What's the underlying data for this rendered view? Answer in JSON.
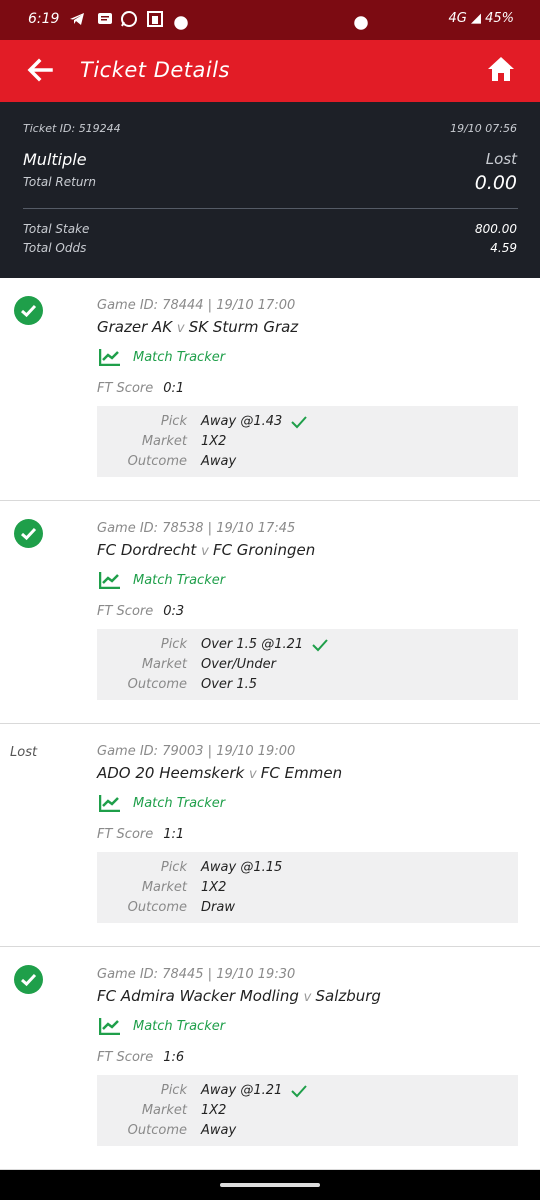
{
  "status_bar": {
    "time": "6:19",
    "right_text": "4G ◢ 45%"
  },
  "header": {
    "title": "Ticket Details"
  },
  "summary": {
    "ticket_id": "Ticket ID: 519244",
    "datetime": "19/10 07:56",
    "bet_type": "Multiple",
    "result": "Lost",
    "total_return_label": "Total Return",
    "total_return_value": "0.00",
    "total_stake_label": "Total Stake",
    "total_stake_value": "800.00",
    "total_odds_label": "Total Odds",
    "total_odds_value": "4.59"
  },
  "labels": {
    "match_tracker": "Match Tracker",
    "ft_score": "FT Score",
    "pick": "Pick",
    "market": "Market",
    "outcome": "Outcome",
    "versus": "v"
  },
  "games": [
    {
      "status": "won",
      "game_id": "Game ID: 78444 | 19/10 17:00",
      "home": "Grazer AK",
      "away": "SK Sturm Graz",
      "ft_score": "0:1",
      "pick": "Away @1.43",
      "market": "1X2",
      "outcome": "Away"
    },
    {
      "status": "won",
      "game_id": "Game ID: 78538 | 19/10 17:45",
      "home": "FC Dordrecht",
      "away": "FC Groningen",
      "ft_score": "0:3",
      "pick": "Over 1.5 @1.21",
      "market": "Over/Under",
      "outcome": "Over 1.5"
    },
    {
      "status": "lost",
      "status_label": "Lost",
      "game_id": "Game ID: 79003 | 19/10 19:00",
      "home": "ADO 20 Heemskerk",
      "away": "FC Emmen",
      "ft_score": "1:1",
      "pick": "Away @1.15",
      "market": "1X2",
      "outcome": "Draw"
    },
    {
      "status": "won",
      "game_id": "Game ID: 78445 | 19/10 19:30",
      "home": "FC Admira Wacker Modling",
      "away": "Salzburg",
      "ft_score": "1:6",
      "pick": "Away @1.21",
      "market": "1X2",
      "outcome": "Away"
    }
  ],
  "colors": {
    "brand_red": "#e21c26",
    "dark_panel": "#1d2027",
    "win_green": "#1f9f4a"
  }
}
